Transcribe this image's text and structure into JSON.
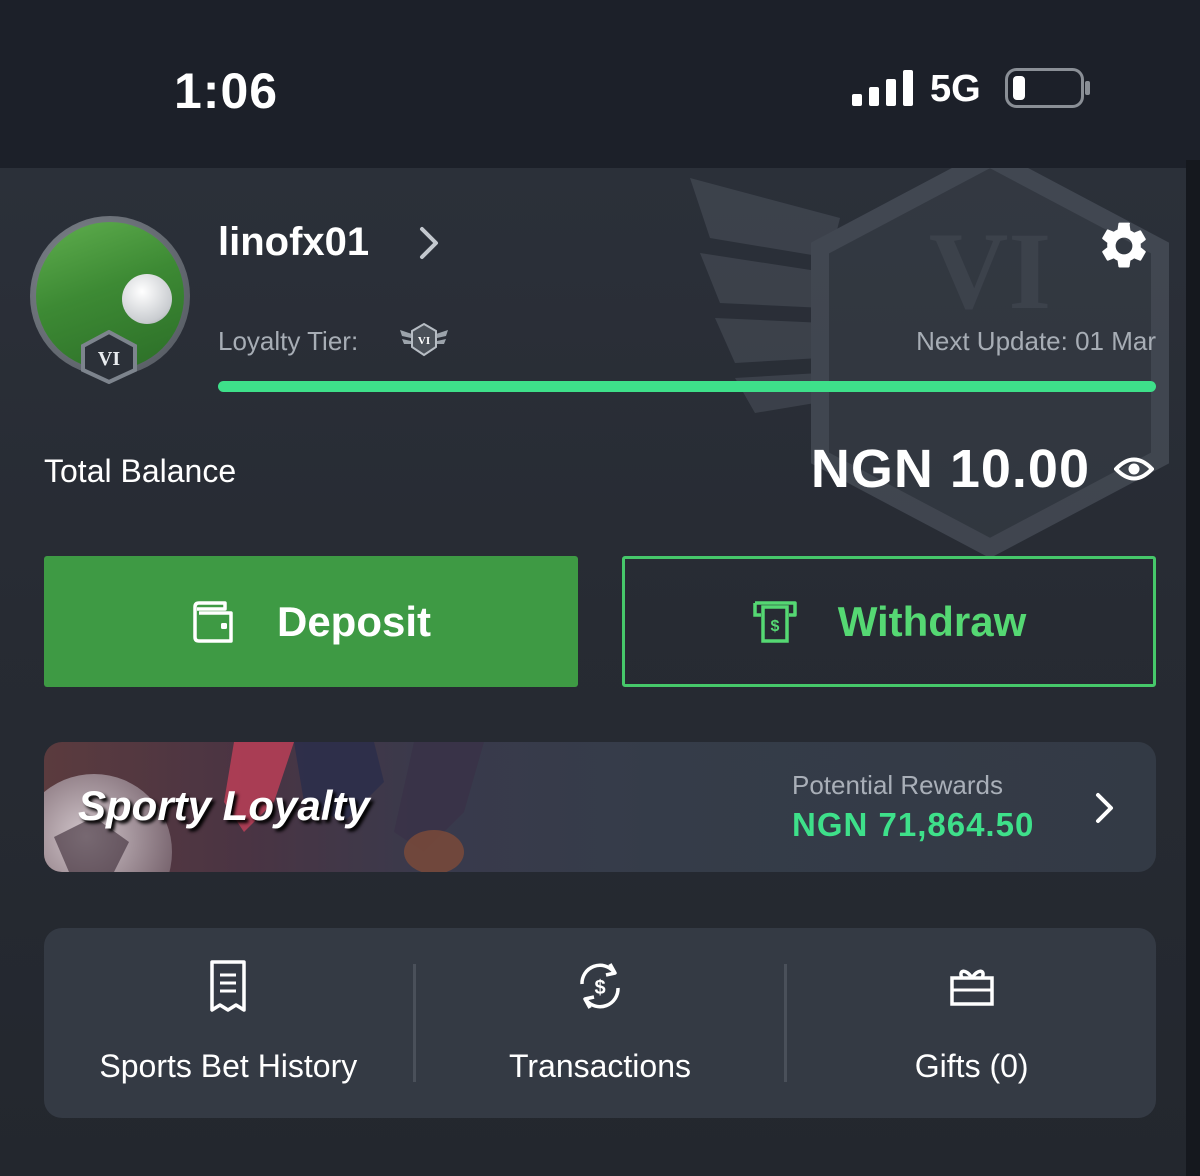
{
  "status_bar": {
    "time": "1:06",
    "network": "5G"
  },
  "profile": {
    "username": "linofx01",
    "avatar_badge": "VI",
    "loyalty_label": "Loyalty Tier:",
    "tier_badge": "VI",
    "next_update": "Next Update: 01 Mar",
    "tier_progress_percent": 100
  },
  "crest_text": "VI",
  "balance": {
    "label": "Total Balance",
    "amount": "NGN 10.00"
  },
  "actions": {
    "deposit_label": "Deposit",
    "withdraw_label": "Withdraw"
  },
  "loyalty_banner": {
    "title": "Sporty Loyalty",
    "rewards_label": "Potential Rewards",
    "rewards_amount": "NGN 71,864.50"
  },
  "quick_links": [
    {
      "label": "Sports Bet History",
      "icon": "receipt-icon"
    },
    {
      "label": "Transactions",
      "icon": "currency-exchange-icon"
    },
    {
      "label": "Gifts (0)",
      "icon": "gift-icon"
    }
  ],
  "colors": {
    "accent_green": "#3ee08a",
    "deposit_green": "#3e9a44",
    "withdraw_green": "#46c86a",
    "background": "#1c2029"
  }
}
